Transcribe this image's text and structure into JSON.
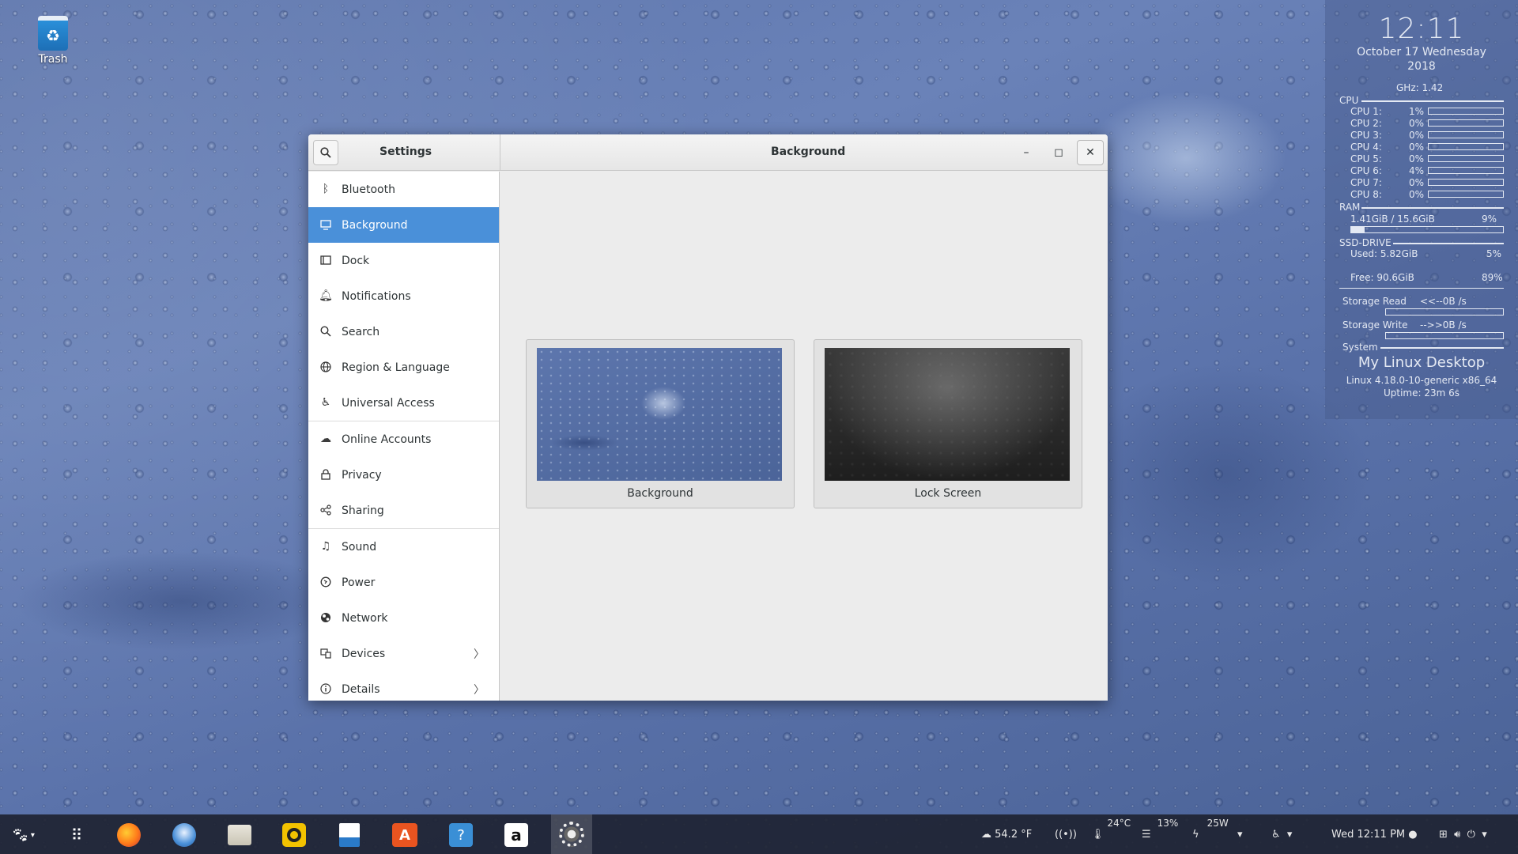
{
  "desktop": {
    "trash_label": "Trash"
  },
  "conky": {
    "time": "12:11",
    "date_line1": "October 17 Wednesday",
    "date_line2": "2018",
    "ghz": "GHz: 1.42",
    "cpu_label": "CPU",
    "cpus": [
      {
        "name": "CPU 1:",
        "pct": "1%"
      },
      {
        "name": "CPU 2:",
        "pct": "0%"
      },
      {
        "name": "CPU 3:",
        "pct": "0%"
      },
      {
        "name": "CPU 4:",
        "pct": "0%"
      },
      {
        "name": "CPU 5:",
        "pct": "0%"
      },
      {
        "name": "CPU 6:",
        "pct": "4%"
      },
      {
        "name": "CPU 7:",
        "pct": "0%"
      },
      {
        "name": "CPU 8:",
        "pct": "0%"
      }
    ],
    "ram_label": "RAM",
    "ram_value": "1.41GiB / 15.6GiB",
    "ram_pct": "9%",
    "ram_fraction": 0.09,
    "ssd_label": "SSD-DRIVE",
    "ssd_used": "Used:  5.82GiB",
    "ssd_used_pct": "5%",
    "ssd_free": "Free:  90.6GiB",
    "ssd_free_pct": "89%",
    "storage_read_label": "Storage Read",
    "storage_read_value": "<<--0B  /s",
    "storage_write_label": "Storage Write",
    "storage_write_value": "-->>0B  /s",
    "system_label": "System",
    "hostname": "My Linux Desktop",
    "kernel": "Linux 4.18.0-10-generic x86_64",
    "uptime": "Uptime: 23m 6s"
  },
  "window": {
    "sidebar_title": "Settings",
    "panel_title": "Background",
    "minimize": "–",
    "maximize": "◻",
    "close": "✕"
  },
  "sidebar": {
    "items": [
      {
        "label": "Bluetooth",
        "icon": "bluetooth-icon"
      },
      {
        "label": "Background",
        "icon": "display-icon",
        "selected": true
      },
      {
        "label": "Dock",
        "icon": "dock-icon"
      },
      {
        "label": "Notifications",
        "icon": "bell-icon"
      },
      {
        "label": "Search",
        "icon": "search-icon"
      },
      {
        "label": "Region & Language",
        "icon": "globe-icon"
      },
      {
        "label": "Universal Access",
        "icon": "accessibility-icon"
      },
      {
        "label": "Online Accounts",
        "icon": "cloud-icon"
      },
      {
        "label": "Privacy",
        "icon": "lock-icon"
      },
      {
        "label": "Sharing",
        "icon": "share-icon"
      },
      {
        "label": "Sound",
        "icon": "music-note-icon"
      },
      {
        "label": "Power",
        "icon": "power-icon"
      },
      {
        "label": "Network",
        "icon": "network-icon"
      },
      {
        "label": "Devices",
        "icon": "devices-icon"
      },
      {
        "label": "Details",
        "icon": "info-icon"
      }
    ]
  },
  "cards": {
    "background": "Background",
    "lock_screen": "Lock Screen"
  },
  "taskbar": {
    "temperature": "54.2 °F",
    "cpu_temp": "24°C",
    "disk": "13%",
    "power": "25W",
    "clock": "Wed 12:11 PM"
  },
  "colors": {
    "selection": "#4a90d9",
    "panel_bg": "#ececec"
  }
}
